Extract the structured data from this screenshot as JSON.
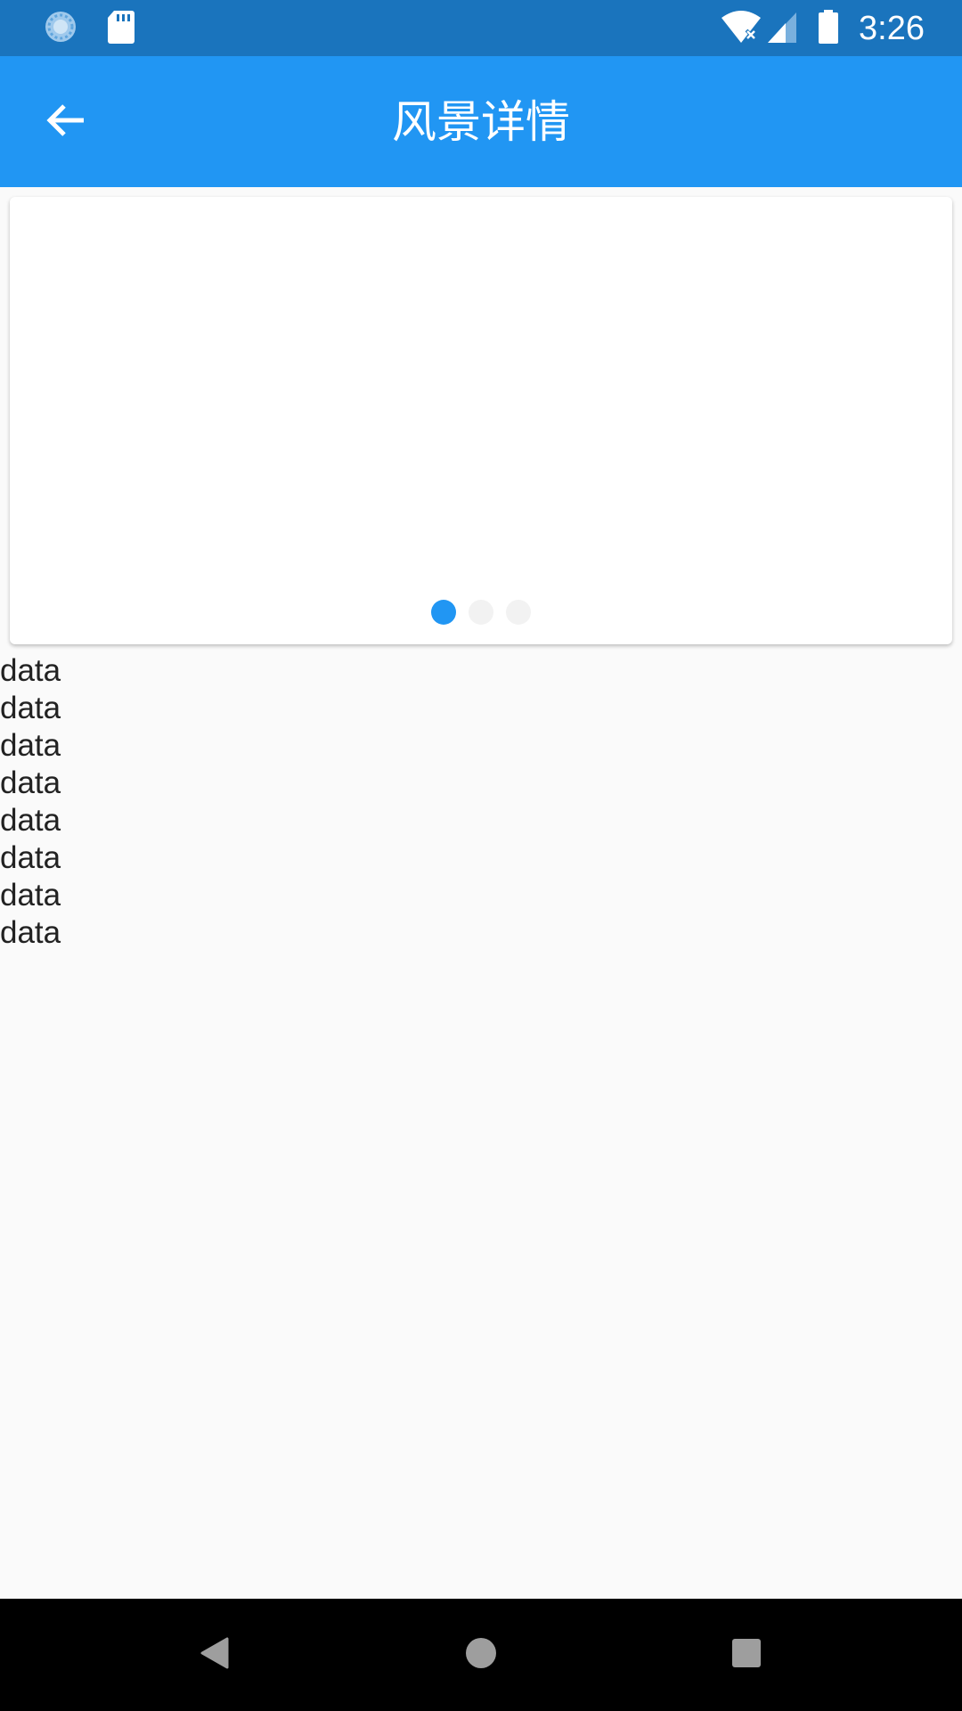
{
  "status_bar": {
    "time": "3:26",
    "icons": [
      "sync-icon",
      "sd-card-icon",
      "wifi-no-internet-icon",
      "cell-signal-icon",
      "battery-icon"
    ]
  },
  "app_bar": {
    "title": "风景详情",
    "back_icon": "arrow-back-icon"
  },
  "carousel": {
    "page_count": 3,
    "active_index": 0,
    "active_color": "#2196f3",
    "inactive_color": "#f2f2f2"
  },
  "list": {
    "items": [
      "data",
      "data",
      "data",
      "data",
      "data",
      "data",
      "data",
      "data"
    ]
  },
  "nav_bar": {
    "icons": [
      "back-triangle-icon",
      "home-circle-icon",
      "recents-square-icon"
    ]
  },
  "colors": {
    "status_bar": "#1a74bd",
    "app_bar": "#2196f3",
    "background": "#fafafa"
  }
}
